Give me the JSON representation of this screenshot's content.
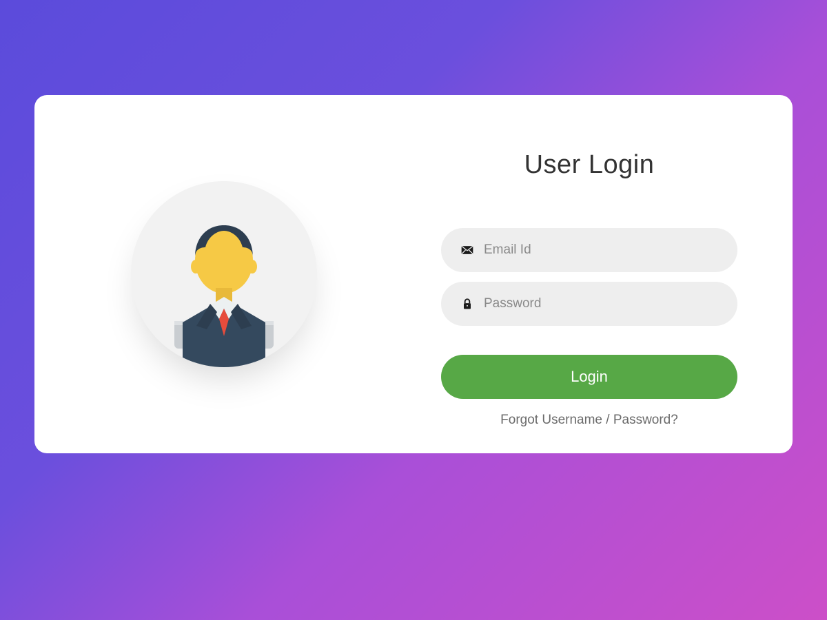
{
  "title": "User Login",
  "form": {
    "email": {
      "placeholder": "Email Id",
      "value": ""
    },
    "password": {
      "placeholder": "Password",
      "value": ""
    },
    "submit_label": "Login",
    "forgot_label": "Forgot Username / Password?"
  },
  "icons": {
    "avatar": "user-avatar-icon",
    "email": "envelope-icon",
    "password": "lock-icon"
  },
  "colors": {
    "button_bg": "#57A846",
    "input_bg": "#EEEEEE",
    "gradient_start": "#5B4BDB",
    "gradient_end": "#CC4FC8"
  }
}
